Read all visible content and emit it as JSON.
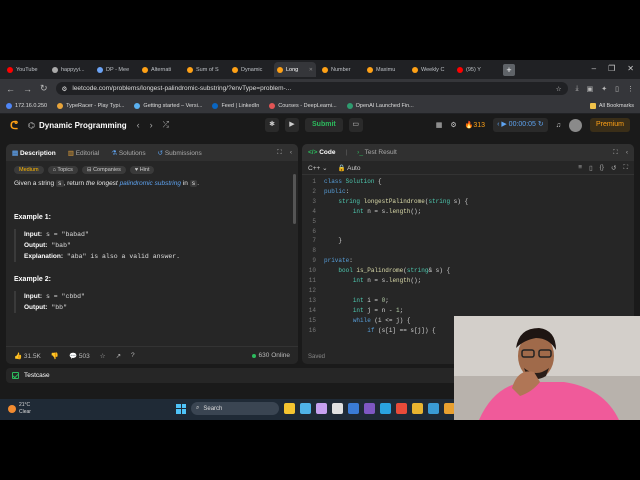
{
  "browser": {
    "tabs": [
      {
        "label": "YouTube",
        "active": false
      },
      {
        "label": "happyyi...",
        "active": false
      },
      {
        "label": "DP - Mee",
        "active": false
      },
      {
        "label": "Alternati",
        "active": false
      },
      {
        "label": "Sum of S",
        "active": false
      },
      {
        "label": "Dynamic",
        "active": false
      },
      {
        "label": "Long",
        "active": true
      },
      {
        "label": "Number",
        "active": false
      },
      {
        "label": "Maximu",
        "active": false
      },
      {
        "label": "Weekly C",
        "active": false
      },
      {
        "label": "(95) Y",
        "active": false
      }
    ],
    "url": "leetcode.com/problems/longest-palindromic-substring/?envType=problem-...",
    "bookmarks": [
      "172.16.0.250",
      "TypeRacer - Play Typi...",
      "Getting started – Versi...",
      "Feed | LinkedIn",
      "Courses - DeepLearni...",
      "OpenAI Launched Fin..."
    ],
    "all_bookmarks": "All Bookmarks"
  },
  "lc": {
    "list_title": "Dynamic Programming",
    "submit": "Submit",
    "streak": "313",
    "timer": "00:00:05",
    "premium": "Premium"
  },
  "left": {
    "tabs": [
      "Description",
      "Editorial",
      "Solutions",
      "Submissions"
    ],
    "title": "5. Longest Palindromic Substring",
    "chips": [
      "Medium",
      "Topics",
      "Companies",
      "Hint"
    ],
    "desc": {
      "p1": "Given a string ",
      "s1": "s",
      "p2": ", return ",
      "em": "the longest",
      "lnk": "palindromic substring",
      "p3": " in ",
      "s2": "s",
      "p4": "."
    },
    "ex1": {
      "title": "Example 1:",
      "input_label": "Input:",
      "input": "s = \"babad\"",
      "output_label": "Output:",
      "output": "\"bab\"",
      "expl_label": "Explanation:",
      "expl": "\"aba\" is also a valid answer."
    },
    "ex2": {
      "title": "Example 2:",
      "input_label": "Input:",
      "input": "s = \"cbbd\"",
      "output_label": "Output:",
      "output": "\"bb\""
    },
    "footer": {
      "likes": "31.5K",
      "comments": "503",
      "online": "630 Online"
    }
  },
  "right": {
    "tabs": [
      "Code",
      "Test Result"
    ],
    "lang": "C++",
    "mode": "Auto",
    "saved": "Saved"
  },
  "code_lines": [
    {
      "n": "1",
      "t": "class Solution {"
    },
    {
      "n": "2",
      "t": "public:"
    },
    {
      "n": "3",
      "t": "    string longestPalindrome(string s) {"
    },
    {
      "n": "4",
      "t": "        int n = s.length();"
    },
    {
      "n": "5",
      "t": ""
    },
    {
      "n": "6",
      "t": ""
    },
    {
      "n": "7",
      "t": "    }"
    },
    {
      "n": "8",
      "t": ""
    },
    {
      "n": "9",
      "t": "private:"
    },
    {
      "n": "10",
      "t": "    bool is_Palindrome(string& s) {"
    },
    {
      "n": "11",
      "t": "        int n = s.length();"
    },
    {
      "n": "12",
      "t": ""
    },
    {
      "n": "13",
      "t": "        int i = 0;"
    },
    {
      "n": "14",
      "t": "        int j = n - 1;"
    },
    {
      "n": "15",
      "t": "        while (i <= j) {"
    },
    {
      "n": "16",
      "t": "            if (s[i] == s[j]) {"
    }
  ],
  "testcase": "Testcase",
  "taskbar": {
    "temp": "21°C",
    "weather": "Clear",
    "search": "Search"
  }
}
